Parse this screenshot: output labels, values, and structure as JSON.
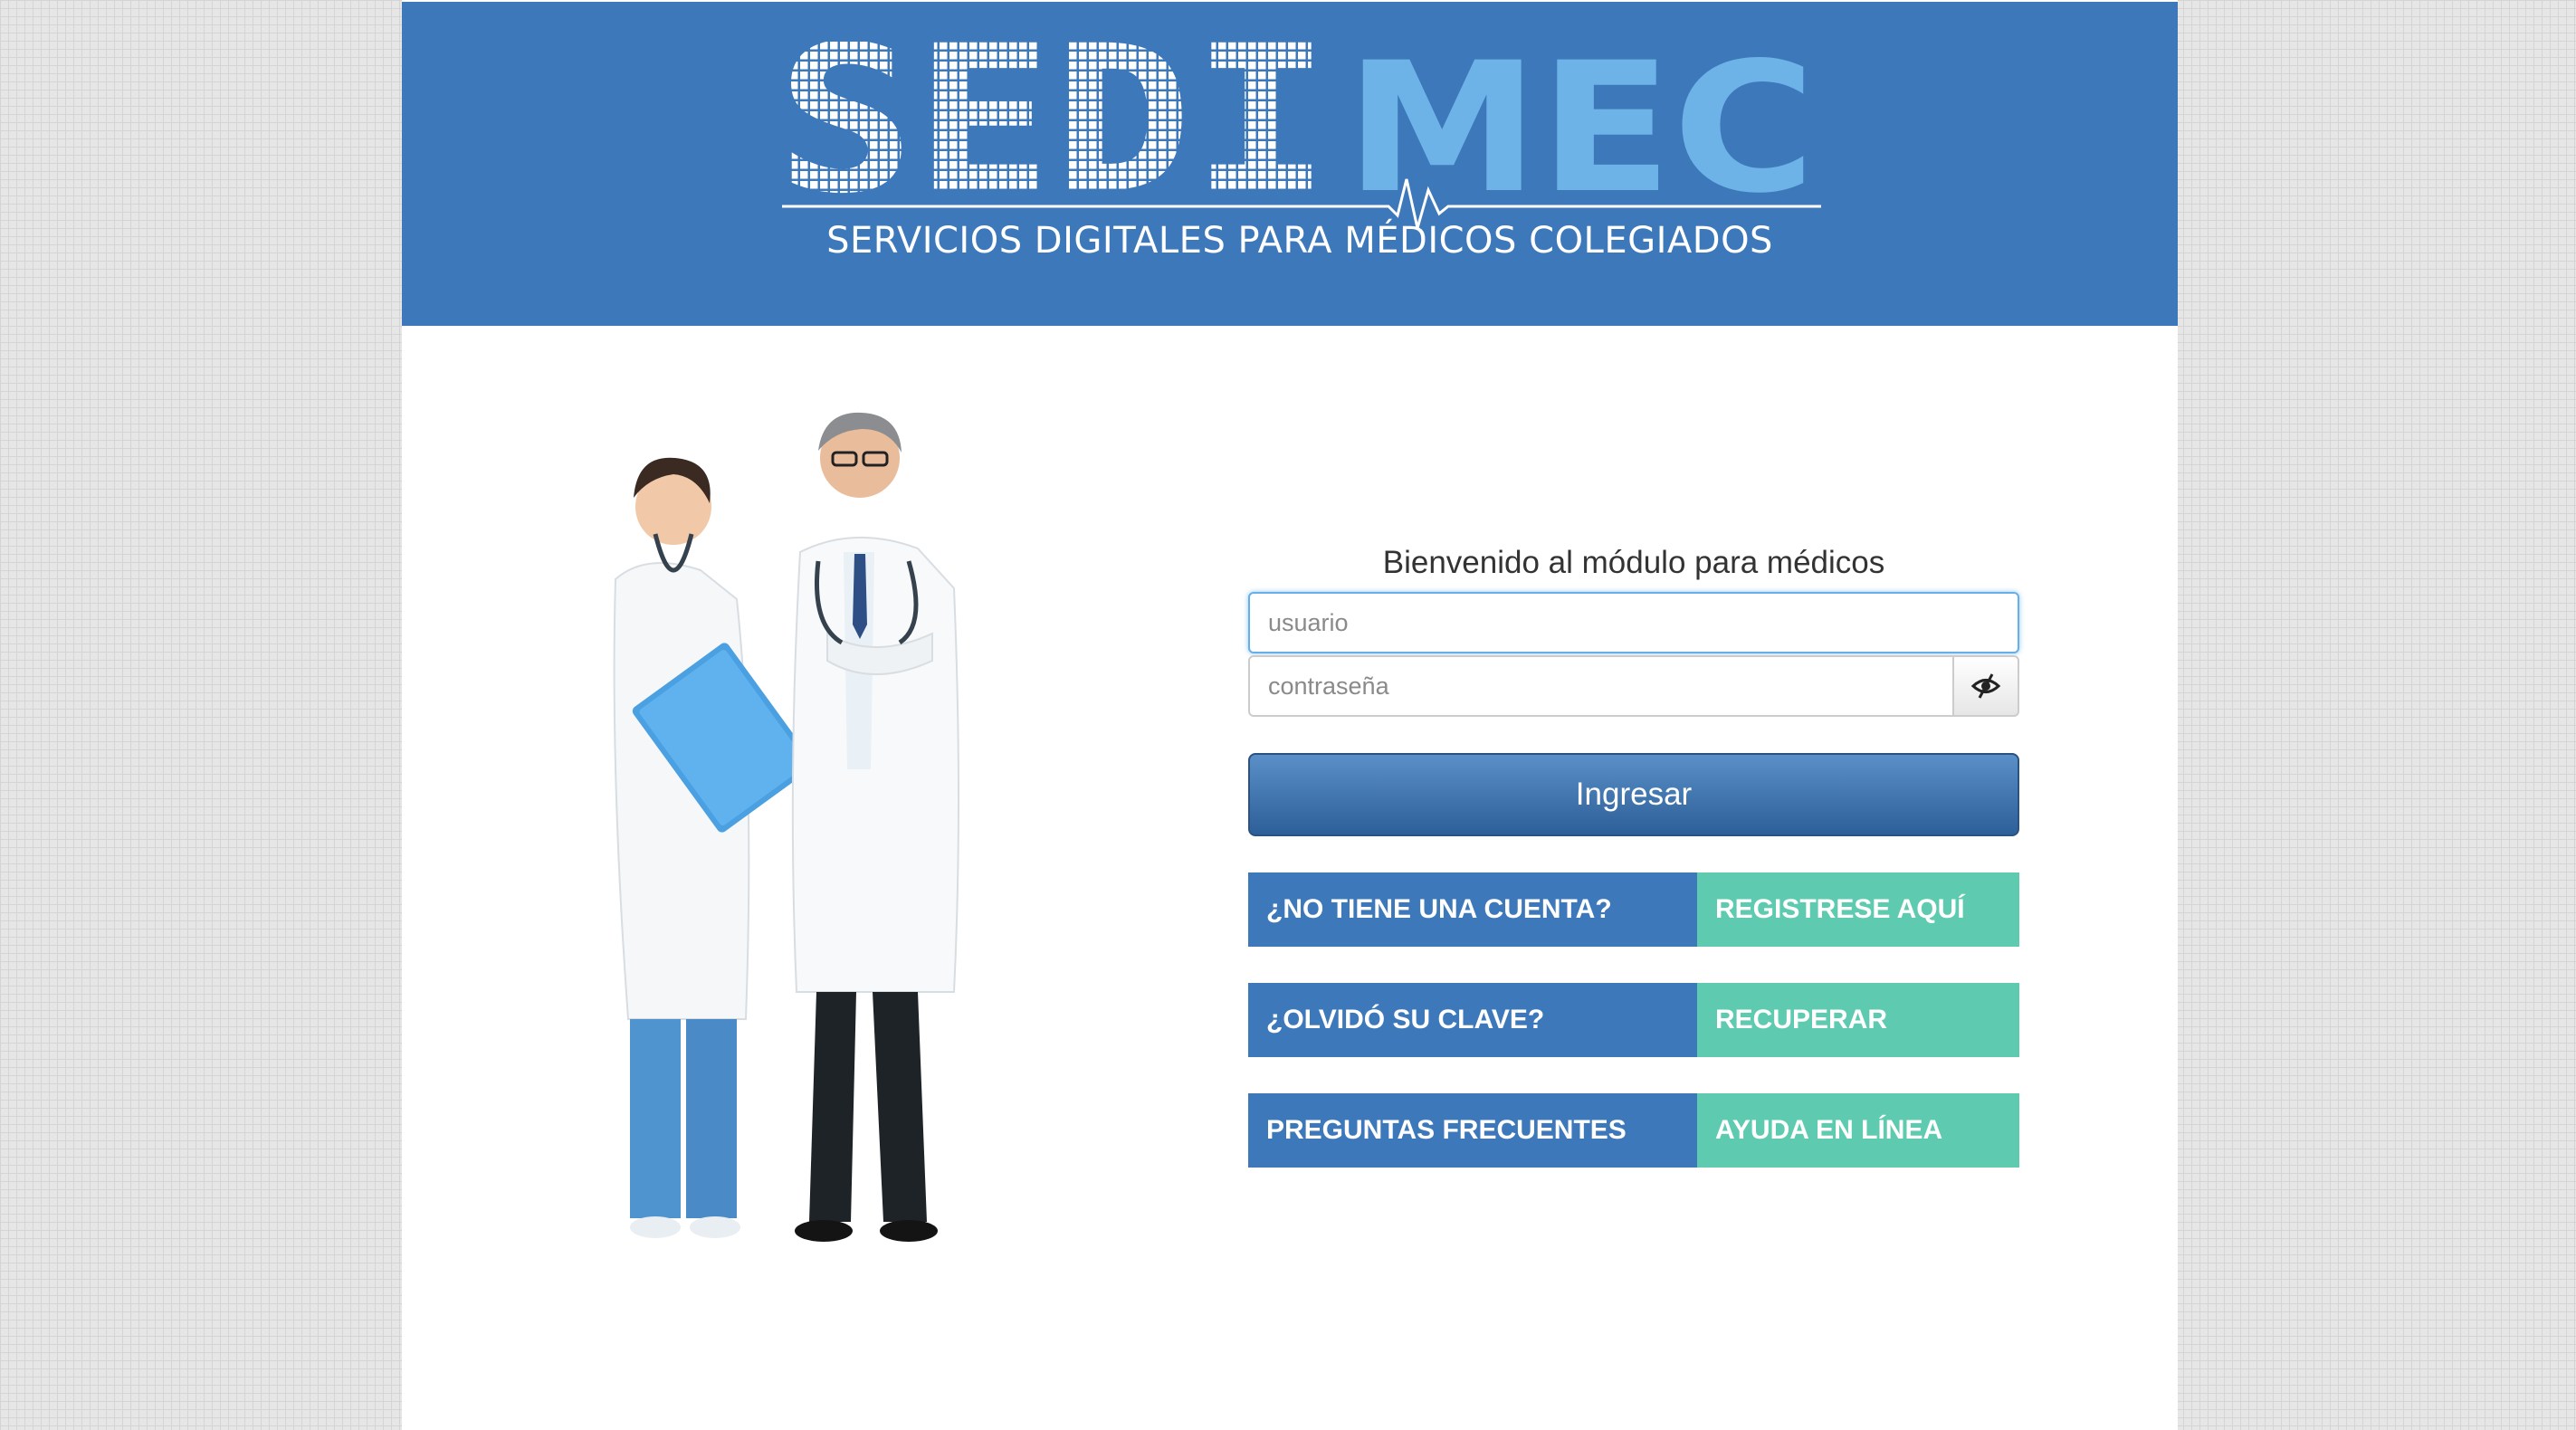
{
  "header": {
    "logo_text_left": "SEDI",
    "logo_text_right": "MEC",
    "tagline": "SERVICIOS DIGITALES PARA MÉDICOS COLEGIADOS",
    "bg_color": "#3d79ba",
    "accent_color": "#6db3e8"
  },
  "login": {
    "welcome": "Bienvenido al módulo para médicos",
    "username_placeholder": "usuario",
    "password_placeholder": "contraseña",
    "toggle_icon": "eye-slash-icon",
    "submit_label": "Ingresar"
  },
  "links": [
    {
      "label": "¿NO TIENE UNA CUENTA?",
      "action": "REGISTRESE AQUÍ"
    },
    {
      "label": "¿OLVIDÓ SU CLAVE?",
      "action": "RECUPERAR"
    },
    {
      "label": "PREGUNTAS FRECUENTES",
      "action": "AYUDA EN LÍNEA"
    }
  ],
  "colors": {
    "primary": "#3d79ba",
    "teal": "#5ecbb0",
    "button": "#2d5f98"
  }
}
